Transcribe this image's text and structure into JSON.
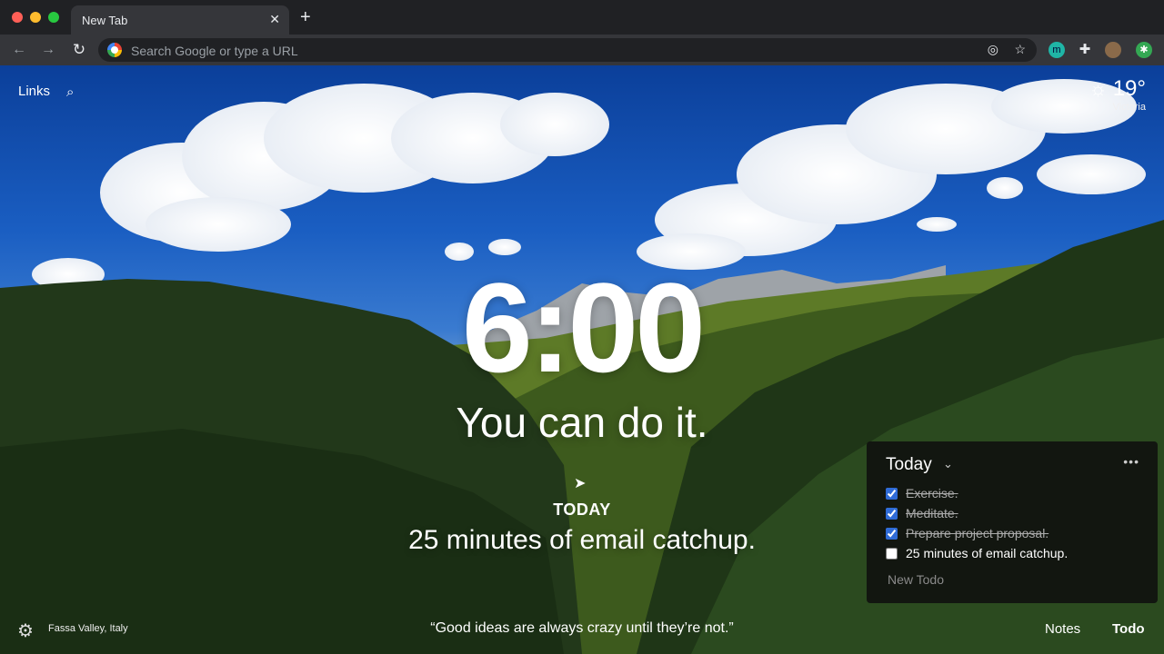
{
  "browser": {
    "tab_title": "New Tab",
    "tab_close": "✕",
    "new_tab": "+",
    "omnibox_placeholder": "Search Google or type a URL",
    "extension_m": "m",
    "extension_star": "✱"
  },
  "dashboard": {
    "links_label": "Links",
    "weather": {
      "temp": "19°",
      "location": "Victoria",
      "icon": "sun-icon"
    },
    "clock": "6:00",
    "mantra": "You can do it.",
    "focus": {
      "label": "TODAY",
      "text": "25 minutes of email catchup."
    },
    "photo_location": "Fassa Valley, Italy",
    "quote": "“Good ideas are always crazy until they’re not.”",
    "notes_label": "Notes",
    "todo_label": "Todo"
  },
  "todo_panel": {
    "title": "Today",
    "items": [
      {
        "text": "Exercise.",
        "done": true
      },
      {
        "text": "Meditate.",
        "done": true
      },
      {
        "text": "Prepare project proposal.",
        "done": true
      },
      {
        "text": "25 minutes of email catchup.",
        "done": false
      }
    ],
    "new_todo_placeholder": "New Todo"
  },
  "colors": {
    "accent": "#2f6bd6",
    "panel_bg": "#0f0f0f",
    "chrome_bg": "#35363a"
  }
}
